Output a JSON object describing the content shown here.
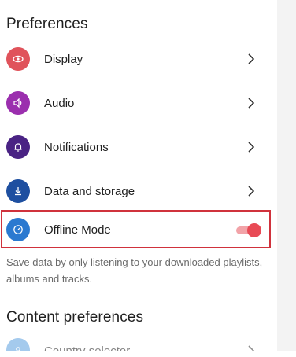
{
  "preferences": {
    "title": "Preferences",
    "items": [
      {
        "label": "Display",
        "icon": "eye-icon",
        "color": "#e0535b"
      },
      {
        "label": "Audio",
        "icon": "speaker-icon",
        "color": "#9b2fae"
      },
      {
        "label": "Notifications",
        "icon": "bell-icon",
        "color": "#4a2384"
      },
      {
        "label": "Data and storage",
        "icon": "download-icon",
        "color": "#1e4fa0"
      }
    ],
    "offline": {
      "label": "Offline Mode",
      "icon": "gauge-icon",
      "color": "#2b79d0",
      "toggle_on": true,
      "toggle_color": "#e84a55",
      "description": "Save data by only listening to your downloaded playlists, albums and tracks."
    }
  },
  "content_preferences": {
    "title": "Content preferences",
    "items": [
      {
        "label": "Country selector",
        "icon": "location-icon",
        "color": "#5aa0e0"
      }
    ]
  }
}
